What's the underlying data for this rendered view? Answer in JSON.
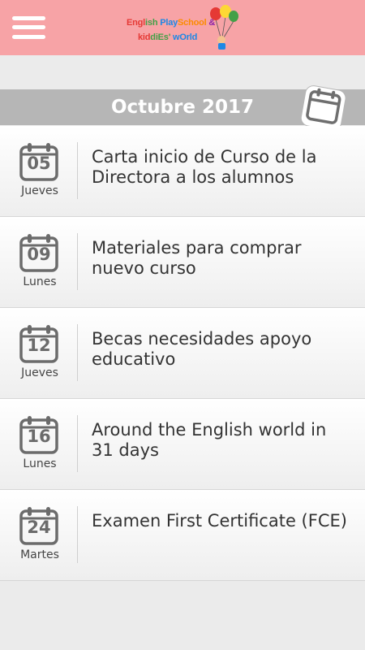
{
  "header": {
    "menu_icon": "hamburger-menu-icon",
    "logo_line1": "English PlaySchool &",
    "logo_line2": "kiddiEs' wOrld",
    "colors": {
      "bar": "#f7a3a6"
    }
  },
  "month": {
    "title": "Octubre 2017",
    "calendar_icon": "calendar-icon"
  },
  "events": [
    {
      "day": "05",
      "weekday": "Jueves",
      "title": "Carta inicio de Curso de la Directora a los alumnos"
    },
    {
      "day": "09",
      "weekday": "Lunes",
      "title": "Materiales para comprar nuevo curso"
    },
    {
      "day": "12",
      "weekday": "Jueves",
      "title": "Becas necesidades apoyo educativo"
    },
    {
      "day": "16",
      "weekday": "Lunes",
      "title": "Around the English world in 31 days"
    },
    {
      "day": "24",
      "weekday": "Martes",
      "title": "Examen First Certificate (FCE)"
    }
  ]
}
